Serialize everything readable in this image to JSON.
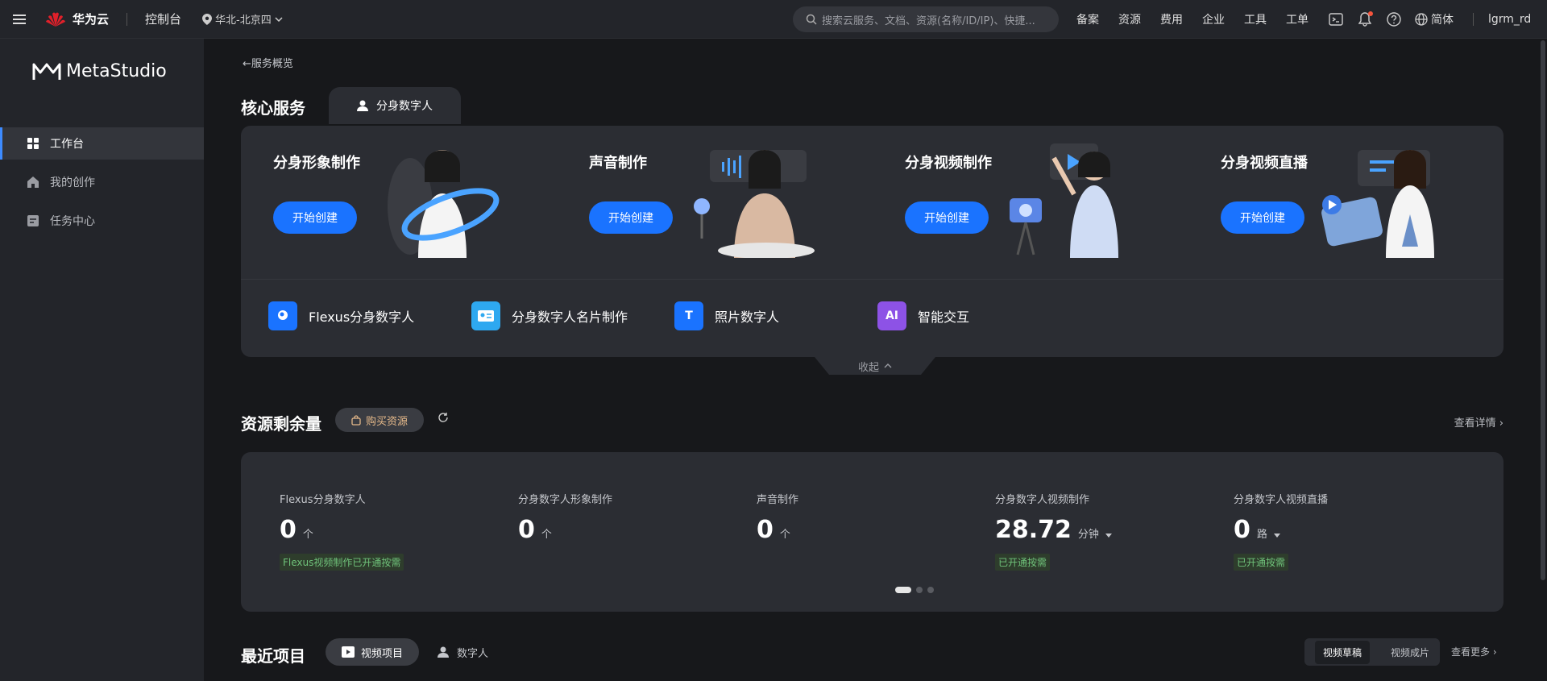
{
  "topbar": {
    "brand": "华为云",
    "console": "控制台",
    "region": "华北-北京四",
    "search_placeholder": "搜索云服务、文档、资源(名称/ID/IP)、快捷...",
    "links": [
      "备案",
      "资源",
      "费用",
      "企业",
      "工具",
      "工单"
    ],
    "language": "简体",
    "user": "lgrm_rd"
  },
  "sidebar": {
    "product": "MetaStudio",
    "items": [
      {
        "label": "工作台",
        "icon": "grid-icon"
      },
      {
        "label": "我的创作",
        "icon": "home-icon"
      },
      {
        "label": "任务中心",
        "icon": "task-icon"
      }
    ]
  },
  "main": {
    "back": "服务概览",
    "core_title": "核心服务",
    "core_tab": "分身数字人",
    "services": [
      {
        "title": "分身形象制作",
        "button": "开始创建"
      },
      {
        "title": "声音制作",
        "button": "开始创建"
      },
      {
        "title": "分身视频制作",
        "button": "开始创建"
      },
      {
        "title": "分身视频直播",
        "button": "开始创建"
      }
    ],
    "tools": [
      {
        "label": "Flexus分身数字人",
        "color": "#1a73ff"
      },
      {
        "label": "分身数字人名片制作",
        "color": "#2ea8f0"
      },
      {
        "label": "照片数字人",
        "color": "#1a73ff"
      },
      {
        "label": "智能交互",
        "color": "#8d52e6"
      }
    ],
    "collapse": "收起",
    "resources": {
      "title": "资源剩余量",
      "buy": "购买资源",
      "detail": "查看详情",
      "items": [
        {
          "label": "Flexus分身数字人",
          "value": "0",
          "unit": "个",
          "badge": "Flexus视频制作已开通按需"
        },
        {
          "label": "分身数字人形象制作",
          "value": "0",
          "unit": "个",
          "badge": ""
        },
        {
          "label": "声音制作",
          "value": "0",
          "unit": "个",
          "badge": ""
        },
        {
          "label": "分身数字人视频制作",
          "value": "28.72",
          "unit": "分钟",
          "badge": "已开通按需"
        },
        {
          "label": "分身数字人视频直播",
          "value": "0",
          "unit": "路",
          "badge": "已开通按需"
        }
      ]
    },
    "recent": {
      "title": "最近项目",
      "tab_video": "视频项目",
      "tab_human": "数字人",
      "seg_draft": "视频草稿",
      "seg_final": "视频成片",
      "more": "查看更多"
    }
  }
}
